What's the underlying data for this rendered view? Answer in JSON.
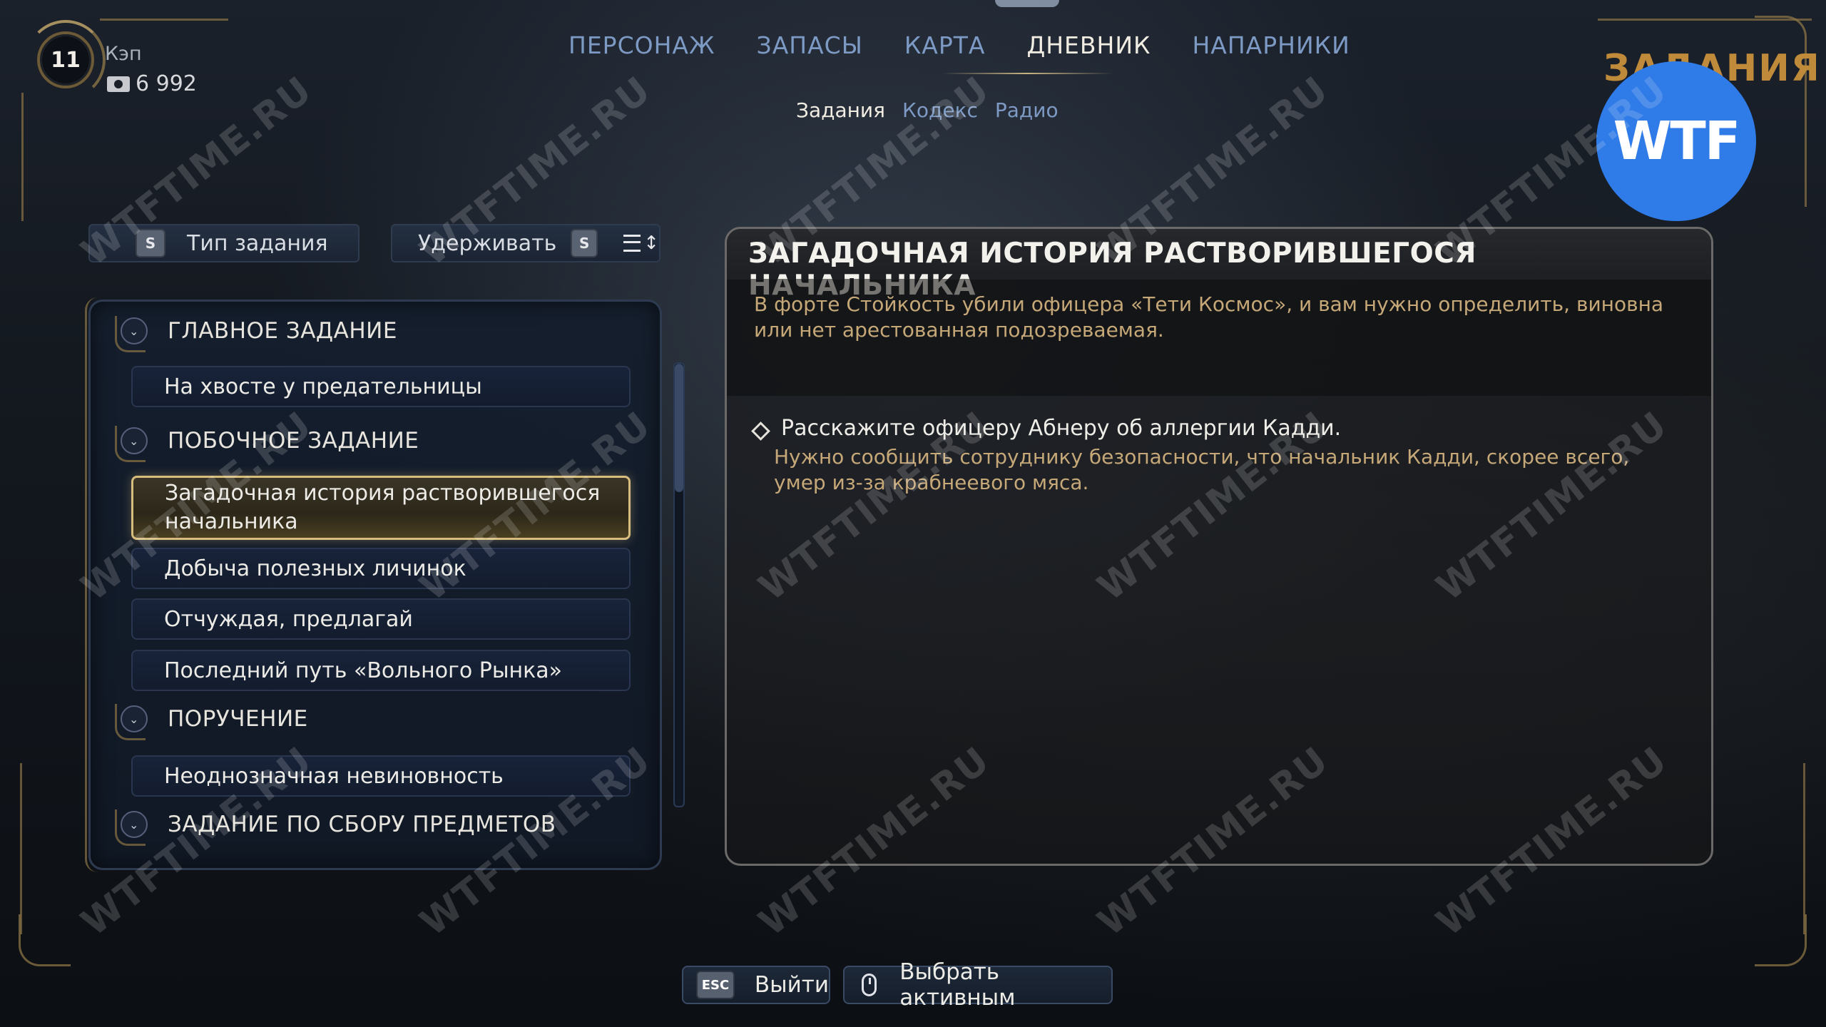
{
  "player": {
    "level": "11",
    "name": "Кэп",
    "currency": "6 992"
  },
  "nav": {
    "tabs": [
      {
        "label": "ПЕРСОНАЖ",
        "active": false
      },
      {
        "label": "ЗАПАСЫ",
        "active": false
      },
      {
        "label": "КАРТА",
        "active": false
      },
      {
        "label": "ДНЕВНИК",
        "active": true
      },
      {
        "label": "НАПАРНИКИ",
        "active": false
      }
    ],
    "subtabs": [
      {
        "label": "Задания",
        "active": true
      },
      {
        "label": "Кодекс",
        "active": false
      },
      {
        "label": "Радио",
        "active": false
      }
    ]
  },
  "section_title": "ЗАДАНИЯ",
  "badge": "WTF",
  "filters": {
    "type_key": "S",
    "type_label": "Тип задания",
    "hold_label": "Удерживать",
    "hold_key": "S"
  },
  "quest_list": {
    "categories": [
      {
        "name": "ГЛАВНОЕ ЗАДАНИЕ",
        "quests": [
          "На хвосте у предательницы"
        ]
      },
      {
        "name": "ПОБОЧНОЕ ЗАДАНИЕ",
        "quests": [
          "Загадочная история растворившегося начальника",
          "Добыча полезных личинок",
          "Отчуждая, предлагай",
          "Последний путь «Вольного Рынка»"
        ]
      },
      {
        "name": "ПОРУЧЕНИЕ",
        "quests": [
          "Неоднозначная невиновность"
        ]
      },
      {
        "name": "ЗАДАНИЕ ПО СБОРУ ПРЕДМЕТОВ",
        "quests": []
      }
    ],
    "selected": "Загадочная история растворившегося начальника"
  },
  "detail": {
    "title": "ЗАГАДОЧНАЯ ИСТОРИЯ РАСТВОРИВШЕГОСЯ НАЧАЛЬНИКА",
    "description": "В форте Стойкость убили офицера «Тети Космос», и вам нужно определить, виновна или нет арестованная подозреваемая.",
    "objective_title": "Расскажите офицеру Абнеру об аллергии Кадди.",
    "objective_text": "Нужно сообщить сотруднику безопасности, что начальник Кадди, скорее всего, умер из-за крабнеевого мяса."
  },
  "controls": {
    "exit_key": "ESC",
    "exit_label": "Выйти",
    "set_active_label": "Выбрать активным"
  },
  "watermark": "WTFTIME.RU",
  "colors": {
    "accent_gold": "#c9ab6b",
    "nav_blue": "#7d9ac4",
    "badge_blue": "#2f7be8",
    "desc_tan": "#c6a878"
  }
}
